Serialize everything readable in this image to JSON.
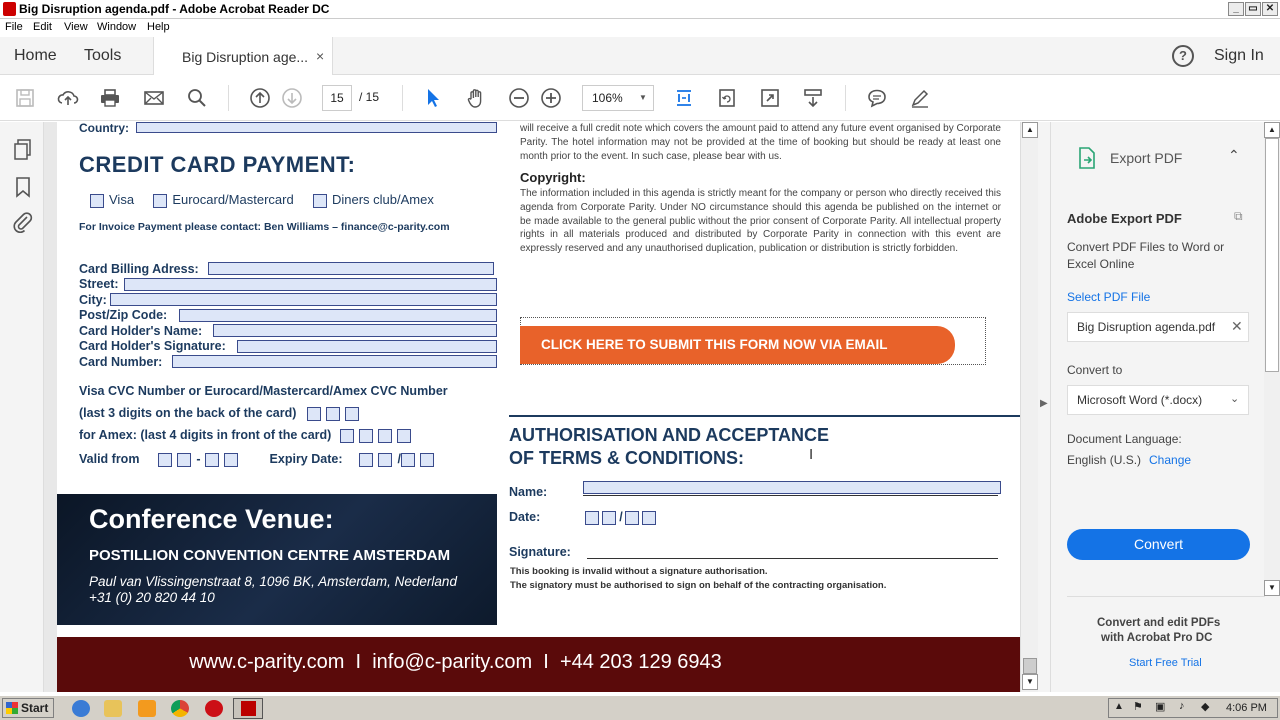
{
  "window": {
    "title": "Big Disruption agenda.pdf - Adobe Acrobat Reader DC",
    "controls": [
      "_",
      "▭",
      "✕"
    ]
  },
  "menu": [
    "File",
    "Edit",
    "View",
    "Window",
    "Help"
  ],
  "nav": {
    "home": "Home",
    "tools": "Tools",
    "tab_label": "Big Disruption age...",
    "tab_close": "×",
    "help": "?",
    "sign_in": "Sign In"
  },
  "toolbar": {
    "current_page": "15",
    "total_pages": "/ 15",
    "zoom": "106%"
  },
  "document": {
    "country_label": "Country:",
    "cc_heading": "CREDIT CARD PAYMENT:",
    "card_options": [
      "Visa",
      "Eurocard/Mastercard",
      "Diners club/Amex"
    ],
    "invoice_contact": "For Invoice Payment please contact: Ben Williams – finance@c-parity.com",
    "fields": [
      "Card Billing Adress:",
      "Street:",
      "City:",
      "Post/Zip Code:",
      "Card Holder's Name:",
      "Card Holder's Signature:",
      "Card Number:"
    ],
    "cvc_line1": "Visa CVC Number or Eurocard/Mastercard/Amex CVC Number",
    "cvc_line2": "(last 3 digits on the back of the card)",
    "amex_line": "for Amex: (last 4 digits in front of the card)",
    "valid_from": "Valid from",
    "dash": "-",
    "slash": "/",
    "expiry": "Expiry Date:",
    "venue_heading": "Conference Venue:",
    "venue_name": "POSTILLION CONVENTION CENTRE AMSTERDAM",
    "venue_address": "Paul van Vlissingenstraat 8, 1096 BK, Amsterdam, Nederland",
    "venue_phone": "+31 (0) 20 820 44 10",
    "credit_note": "will receive a full credit note which covers the amount paid to attend any future event organised by Corporate Parity. The hotel information may not be provided at the time of booking but should be ready at least one month prior to the event. In such case, please bear with us.",
    "copyright_heading": "Copyright:",
    "copyright_text": "The information included in this agenda is strictly meant for the company or person who directly received this agenda from Corporate Parity. Under NO circumstance should this agenda be published on the internet or be made available to the general public without the prior consent of Corporate Parity. All intellectual property rights in all materials produced and distributed by Corporate Parity in connection with this event are expressly reserved and any unauthorised duplication, publication or distribution is strictly forbidden.",
    "submit_button": "CLICK HERE TO SUBMIT THIS FORM NOW VIA EMAIL",
    "auth_heading_1": "AUTHORISATION AND ACCEPTANCE",
    "auth_heading_2": "OF TERMS & CONDITIONS:",
    "name_label": "Name:",
    "date_label": "Date:",
    "signature_label": "Signature:",
    "auth_note_1": "This booking is invalid without a signature authorisation.",
    "auth_note_2": "The signatory must be authorised to sign on behalf of the contracting organisation.",
    "footer": "www.c-parity.com  I  info@c-parity.com  I  +44 203 129 6943"
  },
  "right_pane": {
    "export_title": "Export PDF",
    "section_title": "Adobe Export PDF",
    "description": "Convert PDF Files to Word or Excel Online",
    "select_file": "Select PDF File",
    "file_name": "Big Disruption agenda.pdf",
    "convert_to_label": "Convert to",
    "convert_to_value": "Microsoft Word (*.docx)",
    "doc_language_label": "Document Language:",
    "doc_language_value": "English (U.S.)",
    "change": "Change",
    "convert_button": "Convert",
    "promo_1": "Convert and edit PDFs",
    "promo_2": "with Acrobat Pro DC",
    "trial": "Start Free Trial"
  },
  "taskbar": {
    "start": "Start",
    "time": "4:06 PM"
  },
  "colors": {
    "accent_blue": "#1473e6",
    "navy": "#1c3a5e",
    "orange": "#e8622a",
    "footer_red": "#5a0a0a"
  }
}
